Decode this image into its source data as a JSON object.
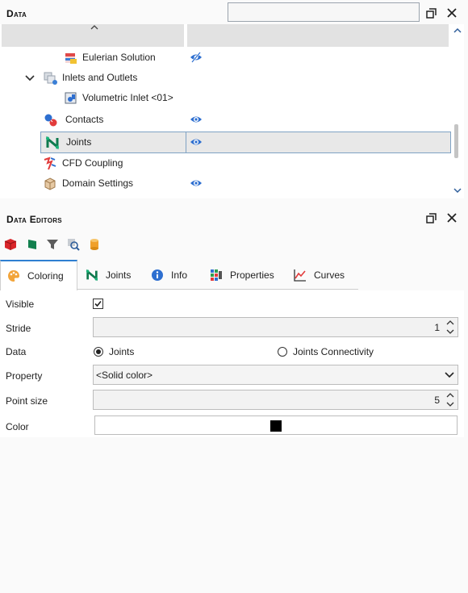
{
  "data_panel": {
    "title": "Data",
    "search_value": "",
    "tree": [
      {
        "label": "Eulerian Solution",
        "icon": "eulerian-solution-icon",
        "visibility": "hidden-eye"
      },
      {
        "label": "Inlets and Outlets",
        "icon": "inlets-outlets-icon",
        "expanded": true,
        "visibility": ""
      },
      {
        "label": "Volumetric Inlet <01>",
        "icon": "volumetric-inlet-icon",
        "visibility": ""
      },
      {
        "label": "Contacts",
        "icon": "contacts-icon",
        "visibility": "eye"
      },
      {
        "label": "Joints",
        "icon": "joints-icon",
        "visibility": "eye",
        "selected": true
      },
      {
        "label": "CFD Coupling",
        "icon": "cfd-coupling-icon",
        "visibility": ""
      },
      {
        "label": "Domain Settings",
        "icon": "domain-settings-icon",
        "visibility": "eye"
      }
    ]
  },
  "editors_panel": {
    "title": "Data Editors",
    "toolbar": [
      "red-cube-icon",
      "green-flag-icon",
      "filter-icon",
      "search-zoom-icon",
      "cylinder-icon"
    ],
    "tabs": [
      {
        "label": "Coloring",
        "icon": "palette-icon",
        "active": true
      },
      {
        "label": "Joints",
        "icon": "joints-icon"
      },
      {
        "label": "Info",
        "icon": "info-icon"
      },
      {
        "label": "Properties",
        "icon": "properties-icon"
      },
      {
        "label": "Curves",
        "icon": "curves-icon"
      }
    ],
    "form": {
      "visible_label": "Visible",
      "visible_checked": true,
      "stride_label": "Stride",
      "stride_value": "1",
      "data_label": "Data",
      "data_option_1": "Joints",
      "data_option_2": "Joints Connectivity",
      "data_selected": "Joints",
      "property_label": "Property",
      "property_value": "<Solid color>",
      "point_size_label": "Point size",
      "point_size_value": "5",
      "color_label": "Color",
      "color_value": "#000000"
    }
  },
  "colors": {
    "accent": "#2f7fd1",
    "eye": "#2e6fd0",
    "selection_border": "#7fa2c4"
  }
}
